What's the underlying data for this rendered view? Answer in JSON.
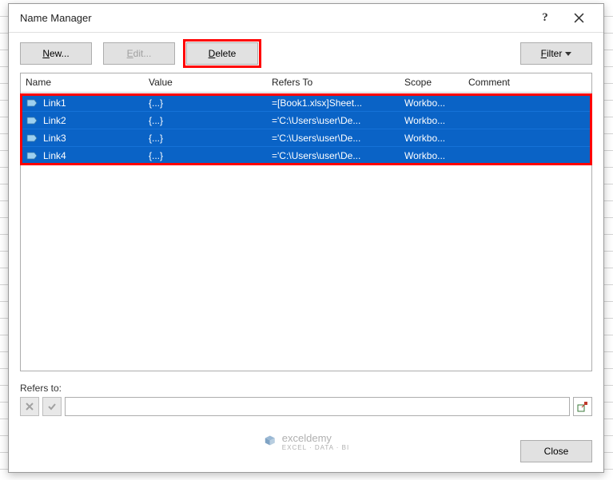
{
  "dialog": {
    "title": "Name Manager",
    "help_label": "?",
    "close_label": "×"
  },
  "toolbar": {
    "new_label": "New...",
    "edit_label": "Edit...",
    "delete_label": "Delete",
    "filter_label": "Filter"
  },
  "columns": {
    "name": "Name",
    "value": "Value",
    "refers": "Refers To",
    "scope": "Scope",
    "comment": "Comment"
  },
  "rows": [
    {
      "name": "Link1",
      "value": "{...}",
      "refers": "=[Book1.xlsx]Sheet...",
      "scope": "Workbo...",
      "comment": ""
    },
    {
      "name": "Link2",
      "value": "{...}",
      "refers": "='C:\\Users\\user\\De...",
      "scope": "Workbo...",
      "comment": ""
    },
    {
      "name": "Link3",
      "value": "{...}",
      "refers": "='C:\\Users\\user\\De...",
      "scope": "Workbo...",
      "comment": ""
    },
    {
      "name": "Link4",
      "value": "{...}",
      "refers": "='C:\\Users\\user\\De...",
      "scope": "Workbo...",
      "comment": ""
    }
  ],
  "refers_section": {
    "label": "Refers to:",
    "value": ""
  },
  "footer": {
    "close_label": "Close"
  },
  "watermark": {
    "brand": "exceldemy",
    "tagline": "EXCEL · DATA · BI"
  }
}
